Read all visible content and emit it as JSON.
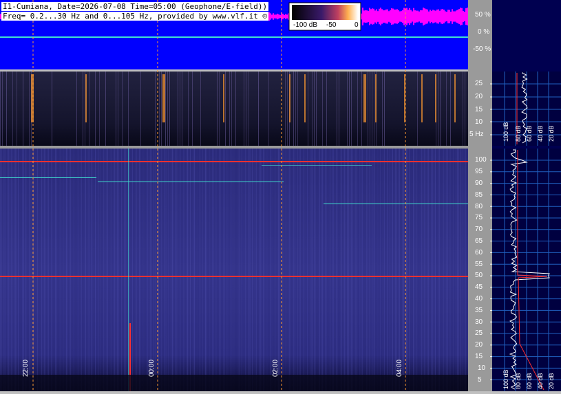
{
  "header": {
    "line1": "I1-Cumiana, Date=2026-07-08 Time=05:00 (Geophone/E-field))",
    "line2": "Freq= 0.2...30 Hz and 0...105 Hz, provided by www.vlf.it ©"
  },
  "colorbar": {
    "labels": [
      "-100 dB",
      "-50",
      "0"
    ]
  },
  "colors": {
    "top_panel_bg": "#0000ff",
    "top_noise": "#ff00ff",
    "line_cyan": "#40e0d0",
    "spectrogram_dark": "#0a0a28",
    "spectrogram_mid": "#3a3a9a",
    "hum_red": "#ff3030",
    "marker_orange": "#ff9a30",
    "side_bg": "#000050"
  },
  "top_axis": {
    "labels": [
      "50 %",
      "0 %",
      "-50 %"
    ]
  },
  "mid_axis": {
    "labels": [
      "25",
      "20",
      "15",
      "10",
      "5 Hz"
    ]
  },
  "bottom_axis": {
    "labels": [
      "100",
      "95",
      "90",
      "85",
      "80",
      "75",
      "70",
      "65",
      "60",
      "55",
      "50",
      "45",
      "40",
      "35",
      "30",
      "25",
      "20",
      "15",
      "10",
      "5"
    ]
  },
  "time_labels": [
    "22:00",
    "00:00",
    "02:00",
    "04:00"
  ],
  "side_labels_mid": [
    "100 dB",
    "80 dB",
    "60 dB",
    "40 dB",
    "20 dB"
  ],
  "side_labels_bottom": [
    "100 dB",
    "80 dB",
    "60 dB",
    "40 dB",
    "20 dB"
  ]
}
